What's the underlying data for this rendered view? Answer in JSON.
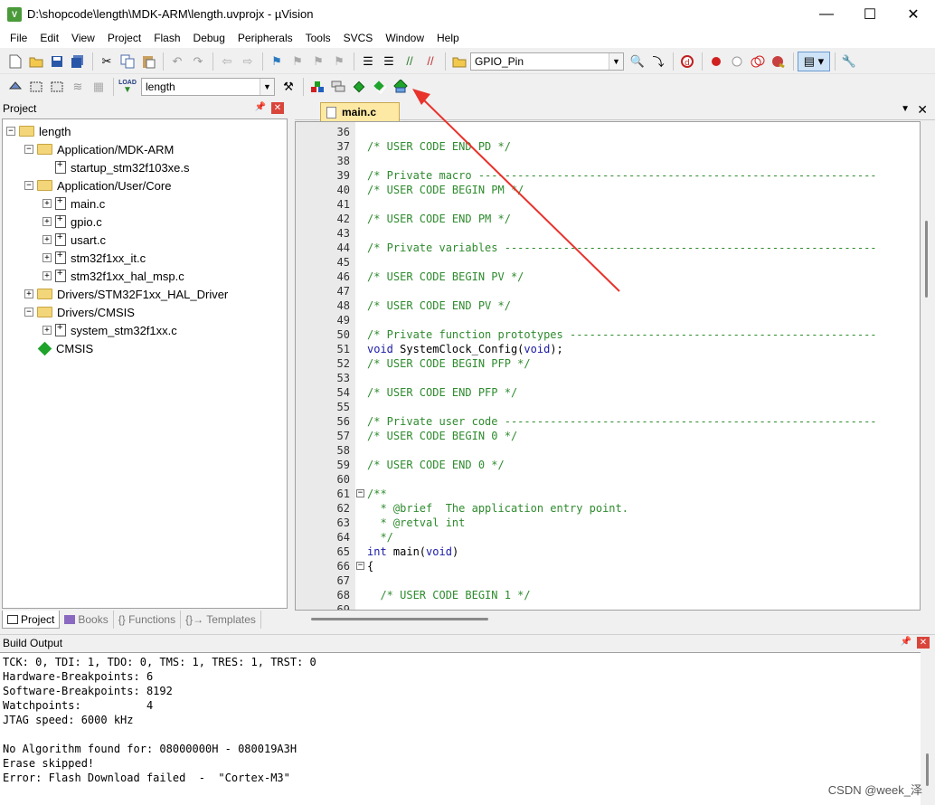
{
  "window": {
    "title": "D:\\shopcode\\length\\MDK-ARM\\length.uvprojx - µVision",
    "minimize": "—",
    "maximize": "☐",
    "close": "✕"
  },
  "menu": [
    "File",
    "Edit",
    "View",
    "Project",
    "Flash",
    "Debug",
    "Peripherals",
    "Tools",
    "SVCS",
    "Window",
    "Help"
  ],
  "toolbar": {
    "target_combo": "GPIO_Pin",
    "project_combo": "length",
    "load_label": "LOAD"
  },
  "project_panel": {
    "title": "Project",
    "tree": [
      {
        "label": "length",
        "type": "root",
        "depth": 0,
        "expander": "−"
      },
      {
        "label": "Application/MDK-ARM",
        "type": "folder",
        "depth": 1,
        "expander": "−"
      },
      {
        "label": "startup_stm32f103xe.s",
        "type": "file",
        "depth": 2,
        "expander": ""
      },
      {
        "label": "Application/User/Core",
        "type": "folder",
        "depth": 1,
        "expander": "−"
      },
      {
        "label": "main.c",
        "type": "file",
        "depth": 2,
        "expander": "+"
      },
      {
        "label": "gpio.c",
        "type": "file",
        "depth": 2,
        "expander": "+"
      },
      {
        "label": "usart.c",
        "type": "file",
        "depth": 2,
        "expander": "+"
      },
      {
        "label": "stm32f1xx_it.c",
        "type": "file",
        "depth": 2,
        "expander": "+"
      },
      {
        "label": "stm32f1xx_hal_msp.c",
        "type": "file",
        "depth": 2,
        "expander": "+"
      },
      {
        "label": "Drivers/STM32F1xx_HAL_Driver",
        "type": "folder",
        "depth": 1,
        "expander": "+"
      },
      {
        "label": "Drivers/CMSIS",
        "type": "folder",
        "depth": 1,
        "expander": "−"
      },
      {
        "label": "system_stm32f1xx.c",
        "type": "file",
        "depth": 2,
        "expander": "+"
      },
      {
        "label": "CMSIS",
        "type": "component",
        "depth": 1,
        "expander": ""
      }
    ],
    "tabs": [
      "Project",
      "Books",
      "{} Functions",
      "{}→ Templates"
    ]
  },
  "editor": {
    "active_tab": "main.c",
    "lines": [
      {
        "n": "36",
        "text": "",
        "cls": ""
      },
      {
        "n": "37",
        "text": "/* USER CODE END PD */",
        "cls": "cm"
      },
      {
        "n": "38",
        "text": "",
        "cls": ""
      },
      {
        "n": "39",
        "text": "/* Private macro -------------------------------------------------------------",
        "cls": "cm"
      },
      {
        "n": "40",
        "text": "/* USER CODE BEGIN PM */",
        "cls": "cm"
      },
      {
        "n": "41",
        "text": "",
        "cls": ""
      },
      {
        "n": "42",
        "text": "/* USER CODE END PM */",
        "cls": "cm"
      },
      {
        "n": "43",
        "text": "",
        "cls": ""
      },
      {
        "n": "44",
        "text": "/* Private variables ---------------------------------------------------------",
        "cls": "cm"
      },
      {
        "n": "45",
        "text": "",
        "cls": ""
      },
      {
        "n": "46",
        "text": "/* USER CODE BEGIN PV */",
        "cls": "cm"
      },
      {
        "n": "47",
        "text": "",
        "cls": ""
      },
      {
        "n": "48",
        "text": "/* USER CODE END PV */",
        "cls": "cm"
      },
      {
        "n": "49",
        "text": "",
        "cls": ""
      },
      {
        "n": "50",
        "text": "/* Private function prototypes -----------------------------------------------",
        "cls": "cm"
      },
      {
        "n": "51",
        "text": "void SystemClock_Config(void);",
        "cls": "code"
      },
      {
        "n": "52",
        "text": "/* USER CODE BEGIN PFP */",
        "cls": "cm"
      },
      {
        "n": "53",
        "text": "",
        "cls": ""
      },
      {
        "n": "54",
        "text": "/* USER CODE END PFP */",
        "cls": "cm"
      },
      {
        "n": "55",
        "text": "",
        "cls": ""
      },
      {
        "n": "56",
        "text": "/* Private user code ---------------------------------------------------------",
        "cls": "cm"
      },
      {
        "n": "57",
        "text": "/* USER CODE BEGIN 0 */",
        "cls": "cm"
      },
      {
        "n": "58",
        "text": "",
        "cls": ""
      },
      {
        "n": "59",
        "text": "/* USER CODE END 0 */",
        "cls": "cm"
      },
      {
        "n": "60",
        "text": "",
        "cls": ""
      },
      {
        "n": "61",
        "text": "/**",
        "cls": "cm"
      },
      {
        "n": "62",
        "text": "  * @brief  The application entry point.",
        "cls": "cm"
      },
      {
        "n": "63",
        "text": "  * @retval int",
        "cls": "cm"
      },
      {
        "n": "64",
        "text": "  */",
        "cls": "cm"
      },
      {
        "n": "65",
        "text": "int main(void)",
        "cls": "code"
      },
      {
        "n": "66",
        "text": "{",
        "cls": ""
      },
      {
        "n": "67",
        "text": "",
        "cls": ""
      },
      {
        "n": "68",
        "text": "  /* USER CODE BEGIN 1 */",
        "cls": "cm"
      },
      {
        "n": "69",
        "text": "",
        "cls": ""
      }
    ]
  },
  "build_output": {
    "title": "Build Output",
    "lines": [
      "TCK: 0, TDI: 1, TDO: 0, TMS: 1, TRES: 1, TRST: 0",
      "Hardware-Breakpoints: 6",
      "Software-Breakpoints: 8192",
      "Watchpoints:          4",
      "JTAG speed: 6000 kHz",
      "",
      "No Algorithm found for: 08000000H - 080019A3H",
      "Erase skipped!",
      "Error: Flash Download failed  -  \"Cortex-M3\""
    ]
  },
  "watermark": "CSDN @week_泽",
  "colors": {
    "comment": "#2e8b2e",
    "keyword": "#1a1aa6",
    "tab_active": "#fde9a4",
    "arrow": "#e8322c",
    "close_button": "#d9453b"
  }
}
